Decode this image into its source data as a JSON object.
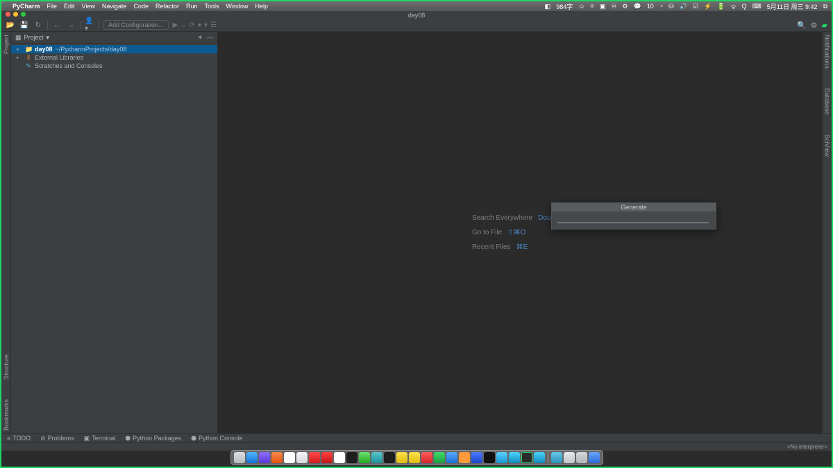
{
  "mac_menu": {
    "app": "PyCharm",
    "items": [
      "File",
      "Edit",
      "View",
      "Navigate",
      "Code",
      "Refactor",
      "Run",
      "Tools",
      "Window",
      "Help"
    ],
    "status_right": [
      "◧",
      "984字",
      "☺",
      "⌾",
      "▣",
      "♾",
      "⚙",
      "💬",
      "10",
      "◔",
      "⛁",
      "🔊",
      "☑",
      "⚡",
      "🔋",
      "ᯤ",
      "Q",
      "⌨",
      "5月11日 周三 9:42",
      "⧉"
    ]
  },
  "window": {
    "title": "day08"
  },
  "toolbar": {
    "config_placeholder": "Add Configuration...",
    "icons_left": [
      "📂",
      "💾",
      "↻"
    ],
    "nav": [
      "←",
      "→"
    ],
    "user": "👤▾",
    "run_icons": [
      "▶",
      "⌄",
      "⟳",
      "⏺",
      "▾",
      "☰"
    ],
    "right": [
      "🔍",
      "⚙",
      "▰"
    ]
  },
  "project_panel": {
    "title": "Project",
    "items": [
      {
        "icon": "▸",
        "type": "folder",
        "label": "day08",
        "path": "~/PycharmProjects/day08",
        "sel": true
      },
      {
        "icon": "▸",
        "type": "lib",
        "label": "External Libraries"
      },
      {
        "icon": "",
        "type": "scratch",
        "label": "Scratches and Consoles"
      }
    ],
    "header_icons": [
      "✶",
      "—"
    ]
  },
  "left_tabs": [
    "Project",
    "Structure",
    "Bookmarks"
  ],
  "right_tabs": [
    "Notifications",
    "Database",
    "SciView"
  ],
  "hints": [
    {
      "label": "Search Everywhere",
      "shortcut": "Double ⇧"
    },
    {
      "label": "Go to File",
      "shortcut": "⇧⌘O"
    },
    {
      "label": "Recent Files",
      "shortcut": "⌘E"
    }
  ],
  "popup": {
    "title": "Generate",
    "input": ""
  },
  "bottom_tabs": [
    {
      "icon": "≡",
      "label": "TODO"
    },
    {
      "icon": "⊘",
      "label": "Problems"
    },
    {
      "icon": "▣",
      "label": "Terminal"
    },
    {
      "icon": "⬢",
      "label": "Python Packages"
    },
    {
      "icon": "⬢",
      "label": "Python Console"
    }
  ],
  "status": {
    "interpreter": "<No interpreter>"
  },
  "dock_count": 29
}
